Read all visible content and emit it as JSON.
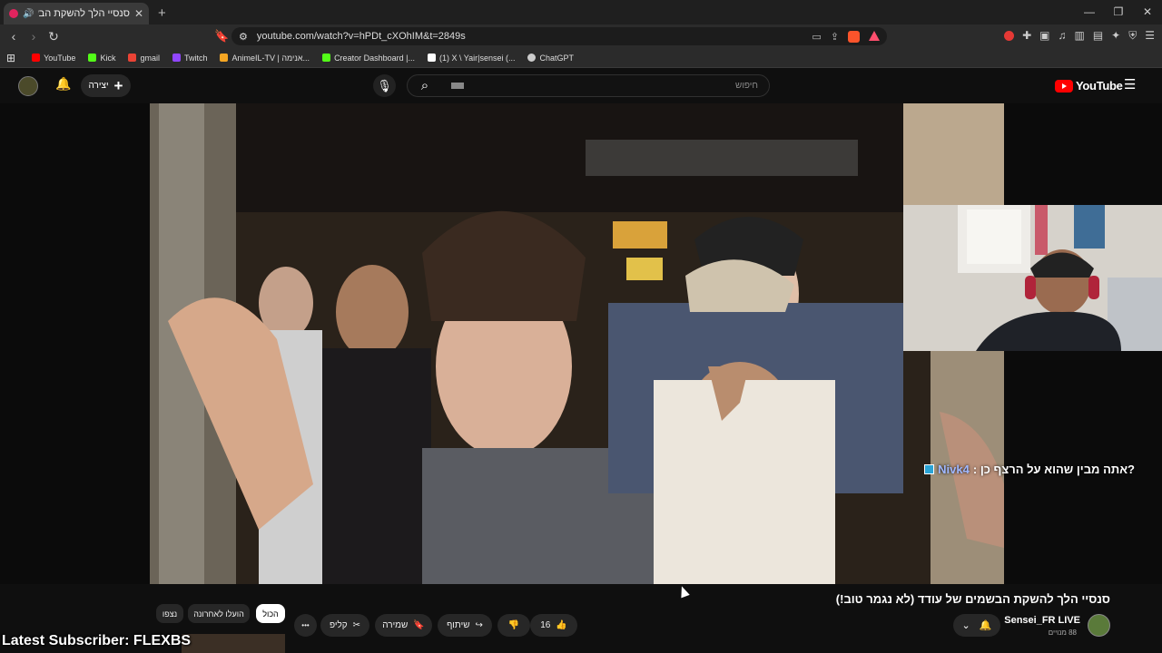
{
  "browser": {
    "tab": {
      "title": "סנסיי הלך להשקת הבשמים ש",
      "close": "✕"
    },
    "new_tab": "+",
    "window_controls": [
      "—",
      "❐",
      "✕"
    ],
    "url": "youtube.com/watch?v=hPDt_cXOhIM&t=2849s",
    "bookmarks": [
      {
        "label": "YouTube",
        "color": "#ff0000"
      },
      {
        "label": "Kick",
        "color": "#53fc18"
      },
      {
        "label": "gmail",
        "color": "#ea4335"
      },
      {
        "label": "Twitch",
        "color": "#9146ff"
      },
      {
        "label": "AnimeIL-TV | אנימה...",
        "color": "#f5a623"
      },
      {
        "label": "Creator Dashboard |...",
        "color": "#53fc18"
      },
      {
        "label": "(1) X \\ Yair|sensei (...",
        "color": "#ffffff"
      },
      {
        "label": "ChatGPT",
        "color": "#cccccc"
      }
    ]
  },
  "youtube": {
    "create_label": "יצירה",
    "search_placeholder": "חיפוש",
    "logo_text": "YouTube"
  },
  "video": {
    "chat_user": "Nivk4",
    "chat_message": "?אתה מבין שהוא על הרצף כן :",
    "title": "סנסיי הלך להשקת הבשמים של עודד (לא נגמר טוב!)",
    "channel": "Sensei_FR LIVE",
    "subscribers": "88 מנויים",
    "likes": "16",
    "share_label": "שיתוף",
    "save_label": "שמירה",
    "clip_label": "קליפ",
    "more_label": "•••"
  },
  "filters": {
    "all": "הכול",
    "recent": "הועלו לאחרונה",
    "watched": "נצפו"
  },
  "overlay_text": "Latest Subscriber: FLEXBS"
}
